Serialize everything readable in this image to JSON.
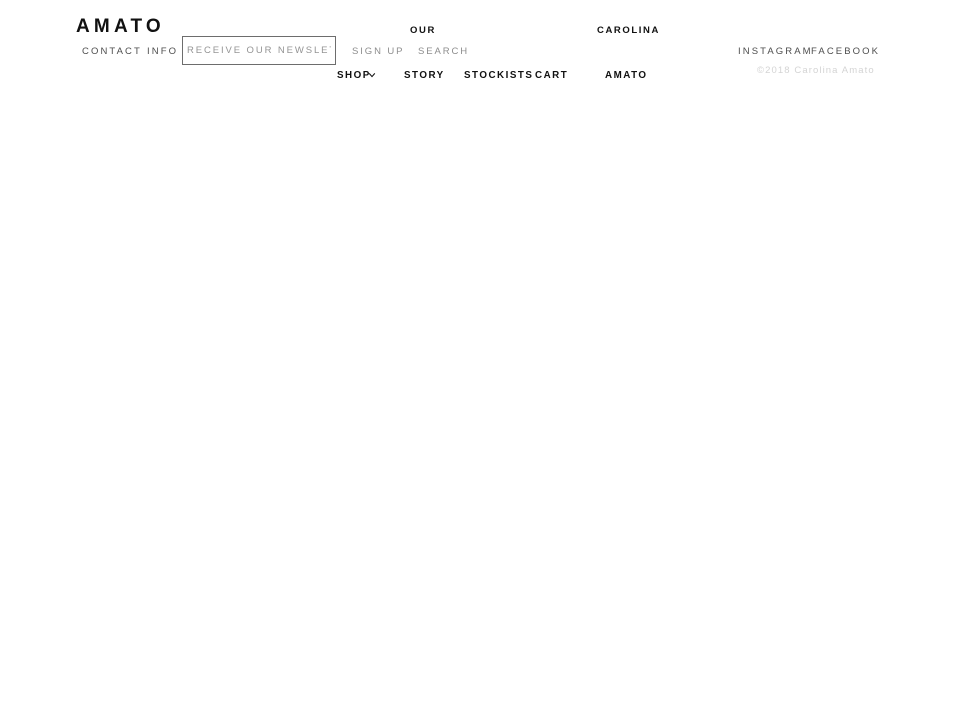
{
  "site": {
    "brand": "AMATO",
    "background_color": "#ffffff"
  },
  "header": {
    "utility_links": [
      {
        "label": "CONTACT",
        "color": "#4e4e4e"
      },
      {
        "label": "INFO",
        "color": "#4e4e4e"
      }
    ],
    "newsletter": {
      "placeholder": "RECEIVE OUR NEWSLETTER",
      "value": "",
      "submit_label": "SIGN UP",
      "border_color": "#6d6d6d"
    },
    "search_label": "SEARCH",
    "headline_words": [
      {
        "label": "OUR"
      },
      {
        "label": "CAROLINA"
      }
    ],
    "nav": [
      {
        "label": "SHOP",
        "has_dropdown": true,
        "icon": "chevron-down-icon"
      },
      {
        "label": "STORY",
        "has_dropdown": false
      },
      {
        "label": "STOCKISTS",
        "has_dropdown": false
      },
      {
        "label": "CART",
        "has_dropdown": false
      },
      {
        "label": "AMATO",
        "has_dropdown": false
      }
    ],
    "social_links": [
      {
        "label": "INSTAGRAM"
      },
      {
        "label": "FACEBOOK"
      }
    ],
    "copyright": "©2018 Carolina Amato",
    "copyright_color": "#d4d4d4"
  }
}
